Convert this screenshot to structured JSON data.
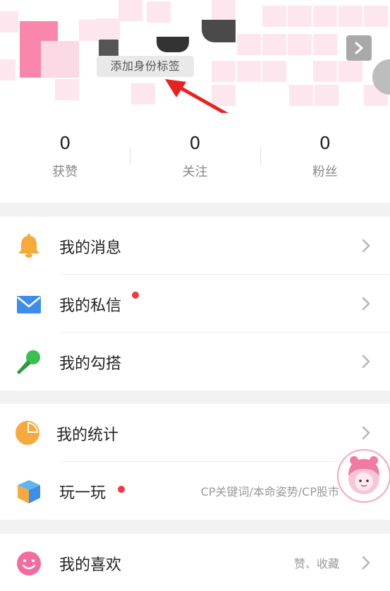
{
  "colors": {
    "accent_pink": "#fb86ab",
    "bell_orange": "#f7a93a",
    "mail_blue": "#3f8dea",
    "mic_green": "#3bbf52",
    "stats_orange": "#f6a93c",
    "smile_pink": "#f46b9e",
    "notify_red": "#f0383e"
  },
  "profile": {
    "tag_label": "添加身份标签"
  },
  "stats": [
    {
      "value": "0",
      "label": "获赞"
    },
    {
      "value": "0",
      "label": "关注"
    },
    {
      "value": "0",
      "label": "粉丝"
    }
  ],
  "menu": {
    "messages": {
      "label": "我的消息",
      "icon": "bell-icon"
    },
    "private_letters": {
      "label": "我的私信",
      "icon": "envelope-icon",
      "has_dot": true
    },
    "hookups": {
      "label": "我的勾搭",
      "icon": "microphone-icon"
    },
    "statistics": {
      "label": "我的统计",
      "icon": "pie-chart-icon"
    },
    "play": {
      "label": "玩一玩",
      "icon": "cube-icon",
      "has_dot": true,
      "hint": "CP关键词/本命姿势/CP股市"
    },
    "likes": {
      "label": "我的喜欢",
      "icon": "smile-icon",
      "hint": "赞、收藏"
    }
  }
}
